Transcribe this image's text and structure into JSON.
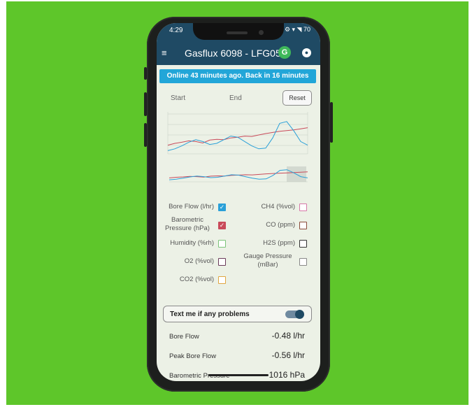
{
  "status": {
    "time": "4:29",
    "icons": "⚙ ▾ ◥ 70"
  },
  "appbar": {
    "title": "Gasflux 6098 - LFG05",
    "logo_letter": "G"
  },
  "banner": "Online 43 minutes ago. Back in 16 minutes",
  "range": {
    "start": "Start",
    "end": "End",
    "reset": "Reset"
  },
  "colors": {
    "appbar": "#1f4a64",
    "banner": "#22a6d8",
    "background": "#5ec62a",
    "screen": "#ecf1e6"
  },
  "checkboxes": [
    {
      "label": "Bore Flow (l/hr)",
      "checked": true,
      "color": "#2aa0d8"
    },
    {
      "label": "CH4 (%vol)",
      "checked": false,
      "color": "#d678a8"
    },
    {
      "label": "Barometric Pressure (hPa)",
      "checked": true,
      "color": "#c94a5a"
    },
    {
      "label": "CO (ppm)",
      "checked": false,
      "color": "#8a4a3a"
    },
    {
      "label": "Humidity (%rh)",
      "checked": false,
      "color": "#7cc47a"
    },
    {
      "label": "H2S (ppm)",
      "checked": false,
      "color": "#333333"
    },
    {
      "label": "O2 (%vol)",
      "checked": false,
      "color": "#6a3a5a"
    },
    {
      "label": "Gauge Pressure (mBar)",
      "checked": false,
      "color": "#888888"
    },
    {
      "label": "CO2 (%vol)",
      "checked": false,
      "color": "#e0a640"
    }
  ],
  "toggle": {
    "label": "Text me if any problems",
    "on": true
  },
  "metrics": [
    {
      "label": "Bore Flow",
      "value": "-0.48 l/hr"
    },
    {
      "label": "Peak Bore Flow",
      "value": "-0.56 l/hr"
    },
    {
      "label": "Barometric Pressure",
      "value": "1016 hPa"
    }
  ],
  "chart_data": {
    "type": "line",
    "x": [
      0,
      1,
      2,
      3,
      4,
      5,
      6,
      7,
      8,
      9,
      10,
      11,
      12,
      13,
      14,
      15,
      16,
      17,
      18,
      19,
      20
    ],
    "series": [
      {
        "color": "#c94a5a",
        "values": [
          0.2,
          0.25,
          0.28,
          0.32,
          0.3,
          0.26,
          0.34,
          0.36,
          0.35,
          0.4,
          0.42,
          0.45,
          0.44,
          0.48,
          0.52,
          0.55,
          0.58,
          0.6,
          0.62,
          0.65,
          0.68
        ]
      },
      {
        "color": "#2aa0d8",
        "values": [
          0.05,
          0.1,
          0.18,
          0.28,
          0.35,
          0.3,
          0.22,
          0.25,
          0.35,
          0.45,
          0.42,
          0.3,
          0.18,
          0.1,
          0.12,
          0.4,
          0.8,
          0.85,
          0.6,
          0.3,
          0.2
        ]
      }
    ],
    "ylim": [
      0,
      1
    ]
  }
}
